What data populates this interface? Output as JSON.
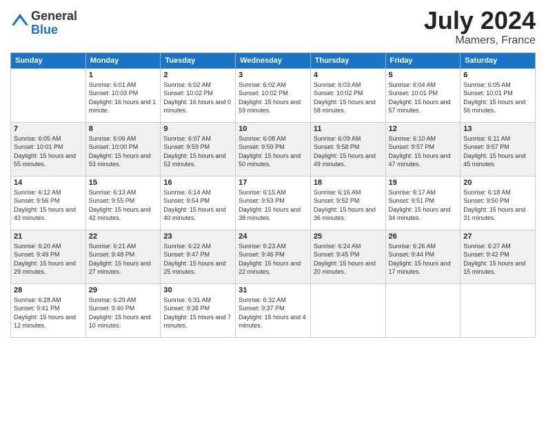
{
  "header": {
    "logo_general": "General",
    "logo_blue": "Blue",
    "month_year": "July 2024",
    "location": "Mamers, France"
  },
  "days_of_week": [
    "Sunday",
    "Monday",
    "Tuesday",
    "Wednesday",
    "Thursday",
    "Friday",
    "Saturday"
  ],
  "weeks": [
    [
      {
        "day": "",
        "sunrise": "",
        "sunset": "",
        "daylight": ""
      },
      {
        "day": "1",
        "sunrise": "Sunrise: 6:01 AM",
        "sunset": "Sunset: 10:03 PM",
        "daylight": "Daylight: 16 hours and 1 minute."
      },
      {
        "day": "2",
        "sunrise": "Sunrise: 6:02 AM",
        "sunset": "Sunset: 10:02 PM",
        "daylight": "Daylight: 16 hours and 0 minutes."
      },
      {
        "day": "3",
        "sunrise": "Sunrise: 6:02 AM",
        "sunset": "Sunset: 10:02 PM",
        "daylight": "Daylight: 15 hours and 59 minutes."
      },
      {
        "day": "4",
        "sunrise": "Sunrise: 6:03 AM",
        "sunset": "Sunset: 10:02 PM",
        "daylight": "Daylight: 15 hours and 58 minutes."
      },
      {
        "day": "5",
        "sunrise": "Sunrise: 6:04 AM",
        "sunset": "Sunset: 10:01 PM",
        "daylight": "Daylight: 15 hours and 57 minutes."
      },
      {
        "day": "6",
        "sunrise": "Sunrise: 6:05 AM",
        "sunset": "Sunset: 10:01 PM",
        "daylight": "Daylight: 15 hours and 56 minutes."
      }
    ],
    [
      {
        "day": "7",
        "sunrise": "Sunrise: 6:05 AM",
        "sunset": "Sunset: 10:01 PM",
        "daylight": "Daylight: 15 hours and 55 minutes."
      },
      {
        "day": "8",
        "sunrise": "Sunrise: 6:06 AM",
        "sunset": "Sunset: 10:00 PM",
        "daylight": "Daylight: 15 hours and 53 minutes."
      },
      {
        "day": "9",
        "sunrise": "Sunrise: 6:07 AM",
        "sunset": "Sunset: 9:59 PM",
        "daylight": "Daylight: 15 hours and 52 minutes."
      },
      {
        "day": "10",
        "sunrise": "Sunrise: 6:08 AM",
        "sunset": "Sunset: 9:59 PM",
        "daylight": "Daylight: 15 hours and 50 minutes."
      },
      {
        "day": "11",
        "sunrise": "Sunrise: 6:09 AM",
        "sunset": "Sunset: 9:58 PM",
        "daylight": "Daylight: 15 hours and 49 minutes."
      },
      {
        "day": "12",
        "sunrise": "Sunrise: 6:10 AM",
        "sunset": "Sunset: 9:57 PM",
        "daylight": "Daylight: 15 hours and 47 minutes."
      },
      {
        "day": "13",
        "sunrise": "Sunrise: 6:11 AM",
        "sunset": "Sunset: 9:57 PM",
        "daylight": "Daylight: 15 hours and 45 minutes."
      }
    ],
    [
      {
        "day": "14",
        "sunrise": "Sunrise: 6:12 AM",
        "sunset": "Sunset: 9:56 PM",
        "daylight": "Daylight: 15 hours and 43 minutes."
      },
      {
        "day": "15",
        "sunrise": "Sunrise: 6:13 AM",
        "sunset": "Sunset: 9:55 PM",
        "daylight": "Daylight: 15 hours and 42 minutes."
      },
      {
        "day": "16",
        "sunrise": "Sunrise: 6:14 AM",
        "sunset": "Sunset: 9:54 PM",
        "daylight": "Daylight: 15 hours and 40 minutes."
      },
      {
        "day": "17",
        "sunrise": "Sunrise: 6:15 AM",
        "sunset": "Sunset: 9:53 PM",
        "daylight": "Daylight: 15 hours and 38 minutes."
      },
      {
        "day": "18",
        "sunrise": "Sunrise: 6:16 AM",
        "sunset": "Sunset: 9:52 PM",
        "daylight": "Daylight: 15 hours and 36 minutes."
      },
      {
        "day": "19",
        "sunrise": "Sunrise: 6:17 AM",
        "sunset": "Sunset: 9:51 PM",
        "daylight": "Daylight: 15 hours and 34 minutes."
      },
      {
        "day": "20",
        "sunrise": "Sunrise: 6:18 AM",
        "sunset": "Sunset: 9:50 PM",
        "daylight": "Daylight: 15 hours and 31 minutes."
      }
    ],
    [
      {
        "day": "21",
        "sunrise": "Sunrise: 6:20 AM",
        "sunset": "Sunset: 9:49 PM",
        "daylight": "Daylight: 15 hours and 29 minutes."
      },
      {
        "day": "22",
        "sunrise": "Sunrise: 6:21 AM",
        "sunset": "Sunset: 9:48 PM",
        "daylight": "Daylight: 15 hours and 27 minutes."
      },
      {
        "day": "23",
        "sunrise": "Sunrise: 6:22 AM",
        "sunset": "Sunset: 9:47 PM",
        "daylight": "Daylight: 15 hours and 25 minutes."
      },
      {
        "day": "24",
        "sunrise": "Sunrise: 6:23 AM",
        "sunset": "Sunset: 9:46 PM",
        "daylight": "Daylight: 15 hours and 22 minutes."
      },
      {
        "day": "25",
        "sunrise": "Sunrise: 6:24 AM",
        "sunset": "Sunset: 9:45 PM",
        "daylight": "Daylight: 15 hours and 20 minutes."
      },
      {
        "day": "26",
        "sunrise": "Sunrise: 6:26 AM",
        "sunset": "Sunset: 9:44 PM",
        "daylight": "Daylight: 15 hours and 17 minutes."
      },
      {
        "day": "27",
        "sunrise": "Sunrise: 6:27 AM",
        "sunset": "Sunset: 9:42 PM",
        "daylight": "Daylight: 15 hours and 15 minutes."
      }
    ],
    [
      {
        "day": "28",
        "sunrise": "Sunrise: 6:28 AM",
        "sunset": "Sunset: 9:41 PM",
        "daylight": "Daylight: 15 hours and 12 minutes."
      },
      {
        "day": "29",
        "sunrise": "Sunrise: 6:29 AM",
        "sunset": "Sunset: 9:40 PM",
        "daylight": "Daylight: 15 hours and 10 minutes."
      },
      {
        "day": "30",
        "sunrise": "Sunrise: 6:31 AM",
        "sunset": "Sunset: 9:38 PM",
        "daylight": "Daylight: 15 hours and 7 minutes."
      },
      {
        "day": "31",
        "sunrise": "Sunrise: 6:32 AM",
        "sunset": "Sunset: 9:37 PM",
        "daylight": "Daylight: 15 hours and 4 minutes."
      },
      {
        "day": "",
        "sunrise": "",
        "sunset": "",
        "daylight": ""
      },
      {
        "day": "",
        "sunrise": "",
        "sunset": "",
        "daylight": ""
      },
      {
        "day": "",
        "sunrise": "",
        "sunset": "",
        "daylight": ""
      }
    ]
  ]
}
